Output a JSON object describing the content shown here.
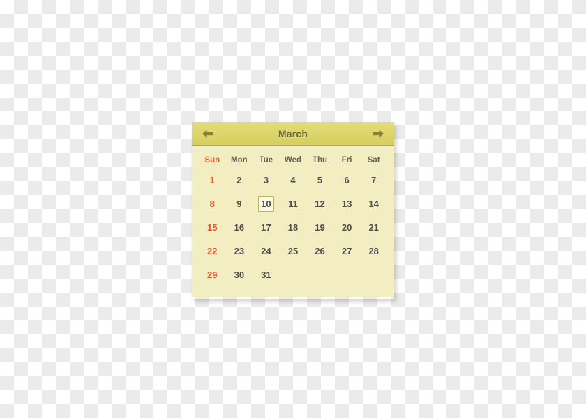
{
  "widget": {
    "name": "calendar-widget",
    "accent_header_color": "#ddd56a",
    "body_color": "#f3eec2",
    "weekend_color": "#e05a2b",
    "text_color": "#4f4d47",
    "selected_border_color": "#bdb25a",
    "selected_bg_color": "#fbf8e6"
  },
  "header": {
    "title": "March",
    "prev_icon": "arrow-left-icon",
    "next_icon": "arrow-right-icon"
  },
  "weekdays": [
    {
      "label": "Sun",
      "weekend": true
    },
    {
      "label": "Mon",
      "weekend": false
    },
    {
      "label": "Tue",
      "weekend": false
    },
    {
      "label": "Wed",
      "weekend": false
    },
    {
      "label": "Thu",
      "weekend": false
    },
    {
      "label": "Fri",
      "weekend": false
    },
    {
      "label": "Sat",
      "weekend": false
    }
  ],
  "weeks": [
    [
      {
        "day": "1",
        "sunday": true,
        "selected": false
      },
      {
        "day": "2",
        "sunday": false,
        "selected": false
      },
      {
        "day": "3",
        "sunday": false,
        "selected": false
      },
      {
        "day": "4",
        "sunday": false,
        "selected": false
      },
      {
        "day": "5",
        "sunday": false,
        "selected": false
      },
      {
        "day": "6",
        "sunday": false,
        "selected": false
      },
      {
        "day": "7",
        "sunday": false,
        "selected": false
      }
    ],
    [
      {
        "day": "8",
        "sunday": true,
        "selected": false
      },
      {
        "day": "9",
        "sunday": false,
        "selected": false
      },
      {
        "day": "10",
        "sunday": false,
        "selected": true
      },
      {
        "day": "11",
        "sunday": false,
        "selected": false
      },
      {
        "day": "12",
        "sunday": false,
        "selected": false
      },
      {
        "day": "13",
        "sunday": false,
        "selected": false
      },
      {
        "day": "14",
        "sunday": false,
        "selected": false
      }
    ],
    [
      {
        "day": "15",
        "sunday": true,
        "selected": false
      },
      {
        "day": "16",
        "sunday": false,
        "selected": false
      },
      {
        "day": "17",
        "sunday": false,
        "selected": false
      },
      {
        "day": "18",
        "sunday": false,
        "selected": false
      },
      {
        "day": "19",
        "sunday": false,
        "selected": false
      },
      {
        "day": "20",
        "sunday": false,
        "selected": false
      },
      {
        "day": "21",
        "sunday": false,
        "selected": false
      }
    ],
    [
      {
        "day": "22",
        "sunday": true,
        "selected": false
      },
      {
        "day": "23",
        "sunday": false,
        "selected": false
      },
      {
        "day": "24",
        "sunday": false,
        "selected": false
      },
      {
        "day": "25",
        "sunday": false,
        "selected": false
      },
      {
        "day": "26",
        "sunday": false,
        "selected": false
      },
      {
        "day": "27",
        "sunday": false,
        "selected": false
      },
      {
        "day": "28",
        "sunday": false,
        "selected": false
      }
    ],
    [
      {
        "day": "29",
        "sunday": true,
        "selected": false
      },
      {
        "day": "30",
        "sunday": false,
        "selected": false
      },
      {
        "day": "31",
        "sunday": false,
        "selected": false
      },
      {
        "day": "",
        "sunday": false,
        "selected": false
      },
      {
        "day": "",
        "sunday": false,
        "selected": false
      },
      {
        "day": "",
        "sunday": false,
        "selected": false
      },
      {
        "day": "",
        "sunday": false,
        "selected": false
      }
    ]
  ]
}
